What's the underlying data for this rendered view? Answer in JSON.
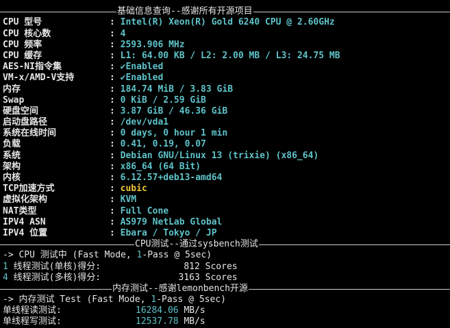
{
  "top_partial": "  ,---.  [---]",
  "sections": {
    "basic": "基础信息查询--感谢所有开源项目",
    "cpu": "CPU测试--通过sysbench测试",
    "mem": "内存测试--感谢lemonbench开源"
  },
  "sysinfo": [
    {
      "key": "CPU 型号",
      "value": "Intel(R) Xeon(R) Gold 6240 CPU @ 2.60GHz"
    },
    {
      "key": "CPU 核心数",
      "value": "4"
    },
    {
      "key": "CPU 频率",
      "value": "2593.906 MHz"
    },
    {
      "key": "CPU 缓存",
      "value": "L1: 64.00 KB / L2: 2.00 MB / L3: 24.75 MB"
    },
    {
      "key": "AES-NI指令集",
      "value": "✔Enabled"
    },
    {
      "key": "VM-x/AMD-V支持",
      "value": "✔Enabled"
    },
    {
      "key": "内存",
      "value": "184.74 MiB / 3.83 GiB"
    },
    {
      "key": "Swap",
      "value": "0 KiB / 2.59 GiB"
    },
    {
      "key": "硬盘空间",
      "value": "3.87 GiB / 46.36 GiB"
    },
    {
      "key": "启动盘路径",
      "value": "/dev/vda1"
    },
    {
      "key": "系统在线时间",
      "value": "0 days, 0 hour 1 min"
    },
    {
      "key": "负载",
      "value": "0.41, 0.19, 0.07"
    },
    {
      "key": "系统",
      "value": "Debian GNU/Linux 13 (trixie) (x86_64)"
    },
    {
      "key": "架构",
      "value": "x86_64 (64 Bit)"
    },
    {
      "key": "内核",
      "value": "6.12.57+deb13-amd64"
    },
    {
      "key": "TCP加速方式",
      "value": "cubic"
    },
    {
      "key": "虚拟化架构",
      "value": "KVM"
    },
    {
      "key": "NAT类型",
      "value": "Full Cone"
    },
    {
      "key": "IPV4 ASN",
      "value": "AS979 NetLab Global"
    },
    {
      "key": "IPV4 位置",
      "value": "Ebara / Tokyo / JP"
    }
  ],
  "cpu_test": {
    "header_prefix": "-> CPU 测试中 (Fast Mode, ",
    "header_num": "1",
    "header_suffix": "-Pass @ 5sec)",
    "rows": [
      {
        "num": "1",
        "label": " 线程测试(单核)得分:",
        "score": "812",
        "unit": " Scores"
      },
      {
        "num": "4",
        "label": " 线程测试(多核)得分:",
        "score": "3163",
        "unit": " Scores"
      }
    ]
  },
  "mem_test": {
    "header_prefix": "-> 内存测试 Test (Fast Mode, ",
    "header_num": "1",
    "header_suffix": "-Pass @ 5sec)",
    "rows": [
      {
        "label": "单线程读测试:",
        "value": "16284.06",
        "unit": " MB/s"
      },
      {
        "label": "单线程写测试:",
        "value": "12537.78",
        "unit": " MB/s"
      }
    ]
  },
  "colors": {
    "background": "#000000",
    "text": "#e6e6e6",
    "value_cyan": "#5ec3c9",
    "value_yellow": "#f0c43a"
  }
}
